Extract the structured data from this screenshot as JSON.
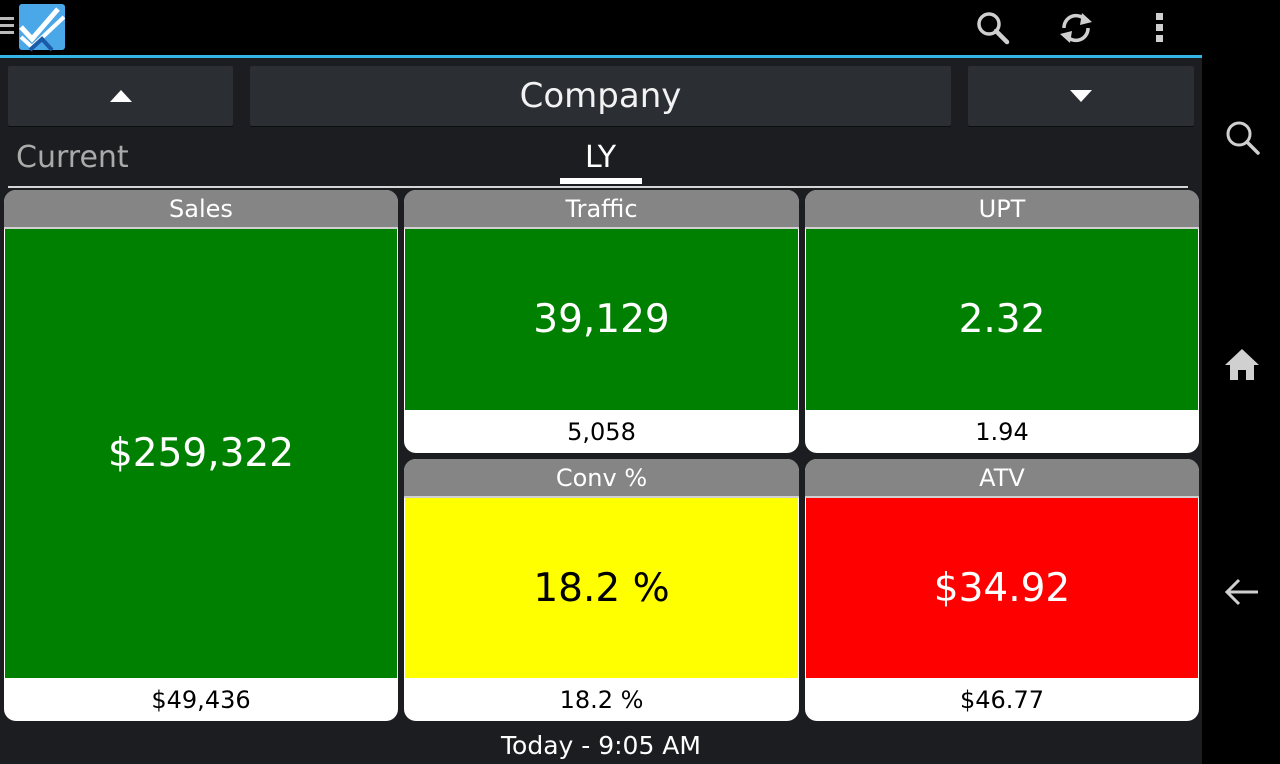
{
  "app": {
    "actions": [
      "search-icon",
      "refresh-icon",
      "overflow-menu-icon"
    ],
    "accent_color": "#33b5e5"
  },
  "navigator": {
    "up_icon": "arrow-up-icon",
    "title": "Company",
    "down_icon": "arrow-down-icon"
  },
  "tabs": [
    {
      "label": "Current",
      "active": false
    },
    {
      "label": "LY",
      "active": true
    }
  ],
  "tiles": {
    "sales": {
      "title": "Sales",
      "value": "$259,322",
      "comparison": "$49,436",
      "status_color": "#008000",
      "value_color": "#ffffff"
    },
    "traffic": {
      "title": "Traffic",
      "value": "39,129",
      "comparison": "5,058",
      "status_color": "#008000",
      "value_color": "#ffffff"
    },
    "upt": {
      "title": "UPT",
      "value": "2.32",
      "comparison": "1.94",
      "status_color": "#008000",
      "value_color": "#ffffff"
    },
    "conv": {
      "title": "Conv %",
      "value": "18.2 %",
      "comparison": "18.2 %",
      "status_color": "#ffff00",
      "value_color": "#000000"
    },
    "atv": {
      "title": "ATV",
      "value": "$34.92",
      "comparison": "$46.77",
      "status_color": "#ff0000",
      "value_color": "#ffffff"
    }
  },
  "footer": {
    "timestamp": "Today - 9:05 AM"
  },
  "system_nav": [
    "search-icon",
    "home-icon",
    "back-icon"
  ]
}
